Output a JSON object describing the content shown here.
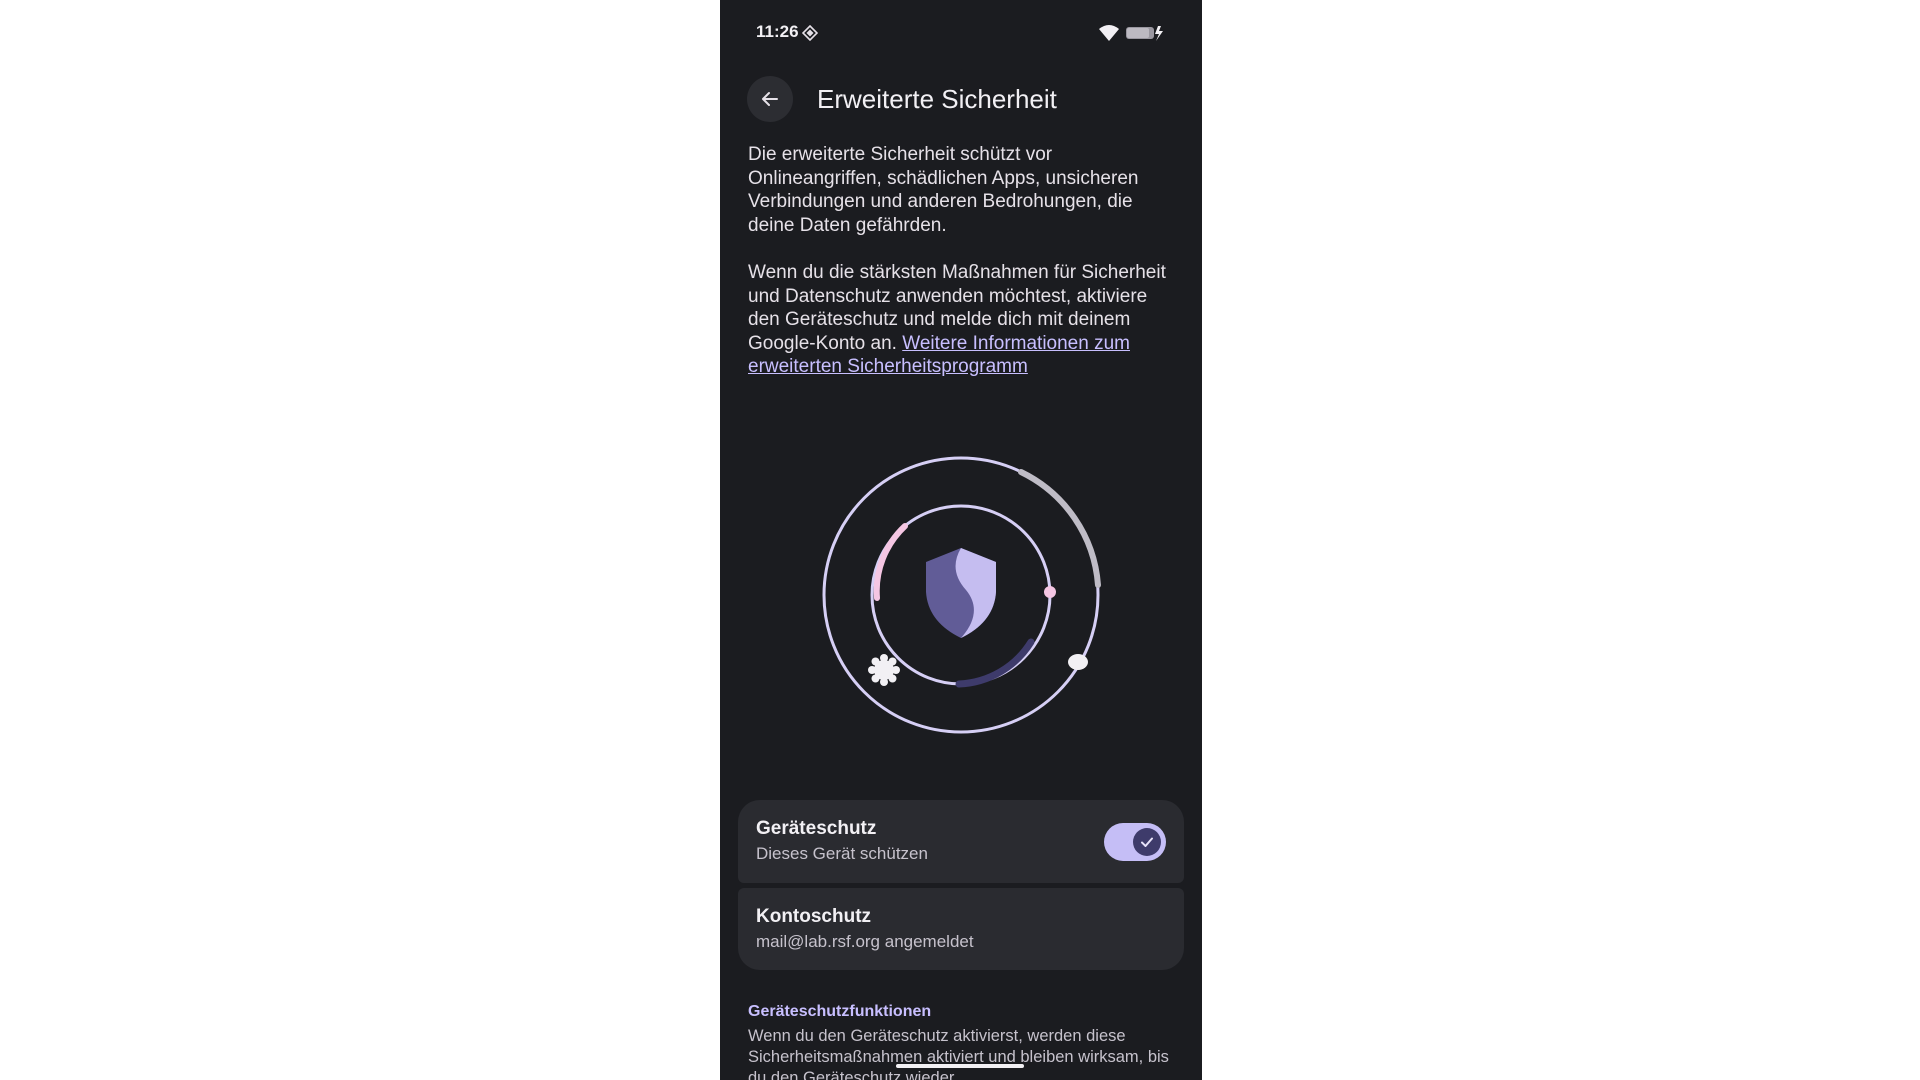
{
  "status_bar": {
    "time": "11:26",
    "icons": [
      "diamond-icon",
      "wifi-icon",
      "battery-charging-icon"
    ]
  },
  "header": {
    "back_icon": "arrow-left-icon",
    "title": "Erweiterte Sicherheit"
  },
  "intro": {
    "paragraph1": "Die erweiterte Sicherheit schützt vor Onlineangriffen, schädlichen Apps, unsicheren Verbindungen und anderen Bedrohungen, die deine Daten gefährden.",
    "paragraph2": "Wenn du die stärksten Maßnahmen für Sicherheit und Datenschutz anwenden möchtest, aktiviere den Geräteschutz und melde dich mit deinem Google-Konto an.",
    "link": "Weitere Informationen zum erweiterten Sicherheitsprogramm"
  },
  "illustration": {
    "icon": "shield-icon",
    "colors": {
      "ring": "#d6cff5",
      "shield_light": "#c5bdf0",
      "shield_dark": "#615c97",
      "accent_pink": "#f5c6e3",
      "arc_gray": "#bfbcc6",
      "arc_dark": "#3e3b6b"
    }
  },
  "protection": {
    "device": {
      "title": "Geräteschutz",
      "subtitle": "Dieses Gerät schützen",
      "toggle_on": true
    },
    "account": {
      "title": "Kontoschutz",
      "subtitle": "mail@lab.rsf.org angemeldet"
    }
  },
  "features": {
    "title": "Geräteschutzfunktionen",
    "body": "Wenn du den Geräteschutz aktivierst, werden diese Sicherheitsmaßnahmen aktiviert und bleiben wirksam, bis du den Geräteschutz wieder"
  },
  "colors": {
    "background": "#1b1c20",
    "card": "#2a2b30",
    "accent": "#c8bfff",
    "toggle_track": "#c5bef6"
  }
}
